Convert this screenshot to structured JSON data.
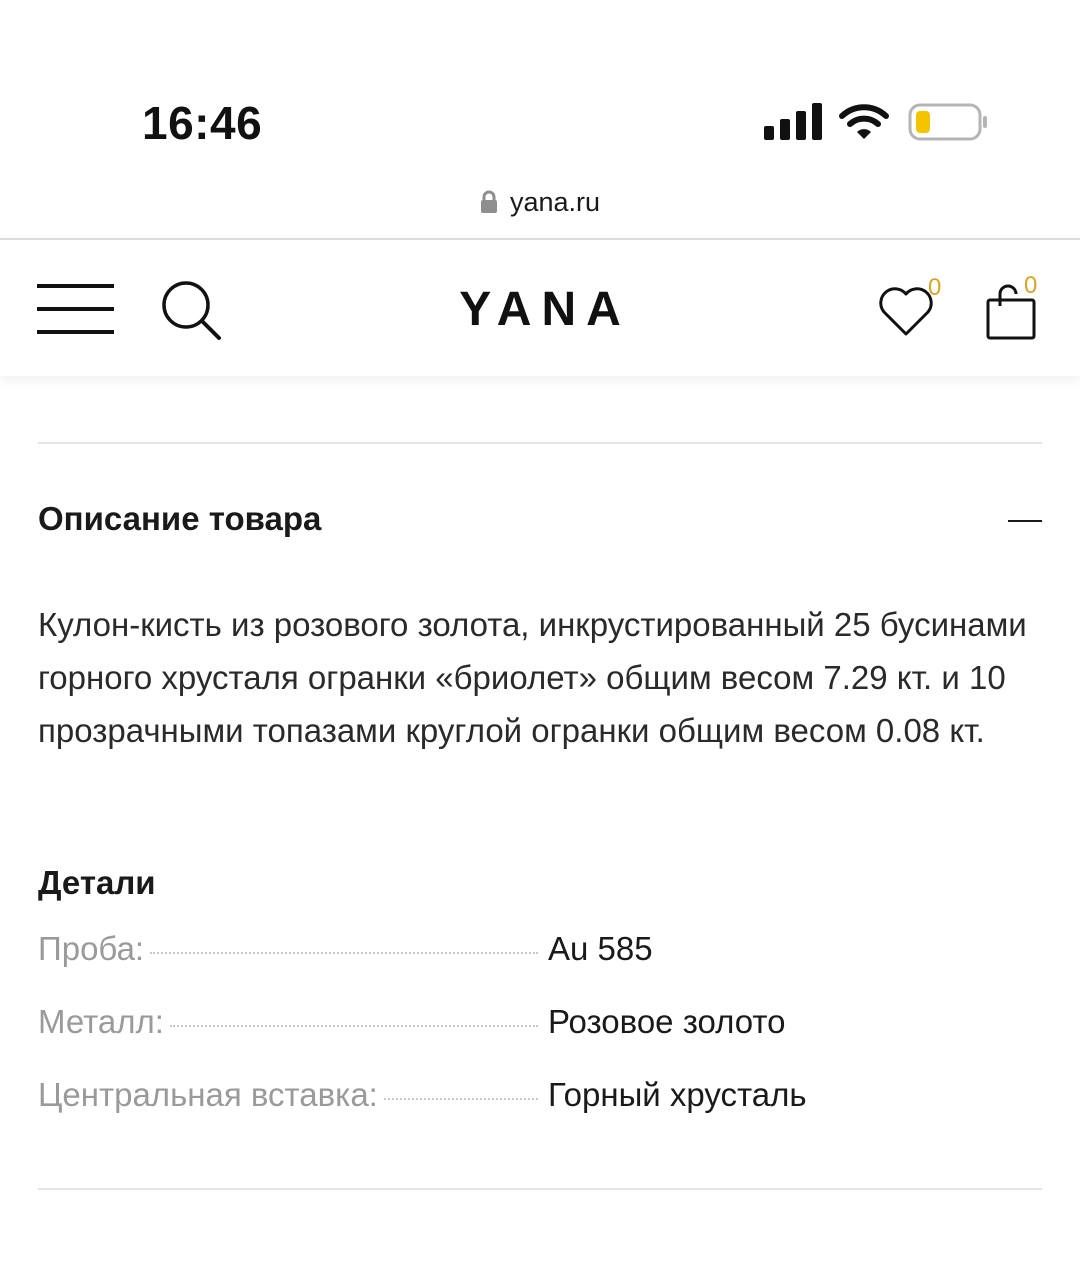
{
  "status_bar": {
    "time": "16:46",
    "signal_icon": "cellular-signal-icon",
    "wifi_icon": "wifi-icon",
    "battery_icon": "battery-low-icon",
    "battery_color": "#f5c400"
  },
  "browser": {
    "url": "yana.ru",
    "lock_icon": "lock-icon"
  },
  "header": {
    "logo": "YANA",
    "wishlist_count": "0",
    "cart_count": "0",
    "badge_color": "#d7a52a"
  },
  "product_description": {
    "title": "Описание товара",
    "text": "Кулон-кисть из розового золота, инкрустированный 25 бусинами горного хрусталя огранки «бриолет» общим весом 7.29 кт. и 10 прозрачными топазами круглой огранки общим весом 0.08 кт."
  },
  "details": {
    "title": "Детали",
    "rows": [
      {
        "label": "Проба:",
        "value": "Au 585"
      },
      {
        "label": "Металл:",
        "value": "Розовое золото"
      },
      {
        "label": "Центральная вставка:",
        "value": "Горный хрусталь"
      }
    ]
  }
}
